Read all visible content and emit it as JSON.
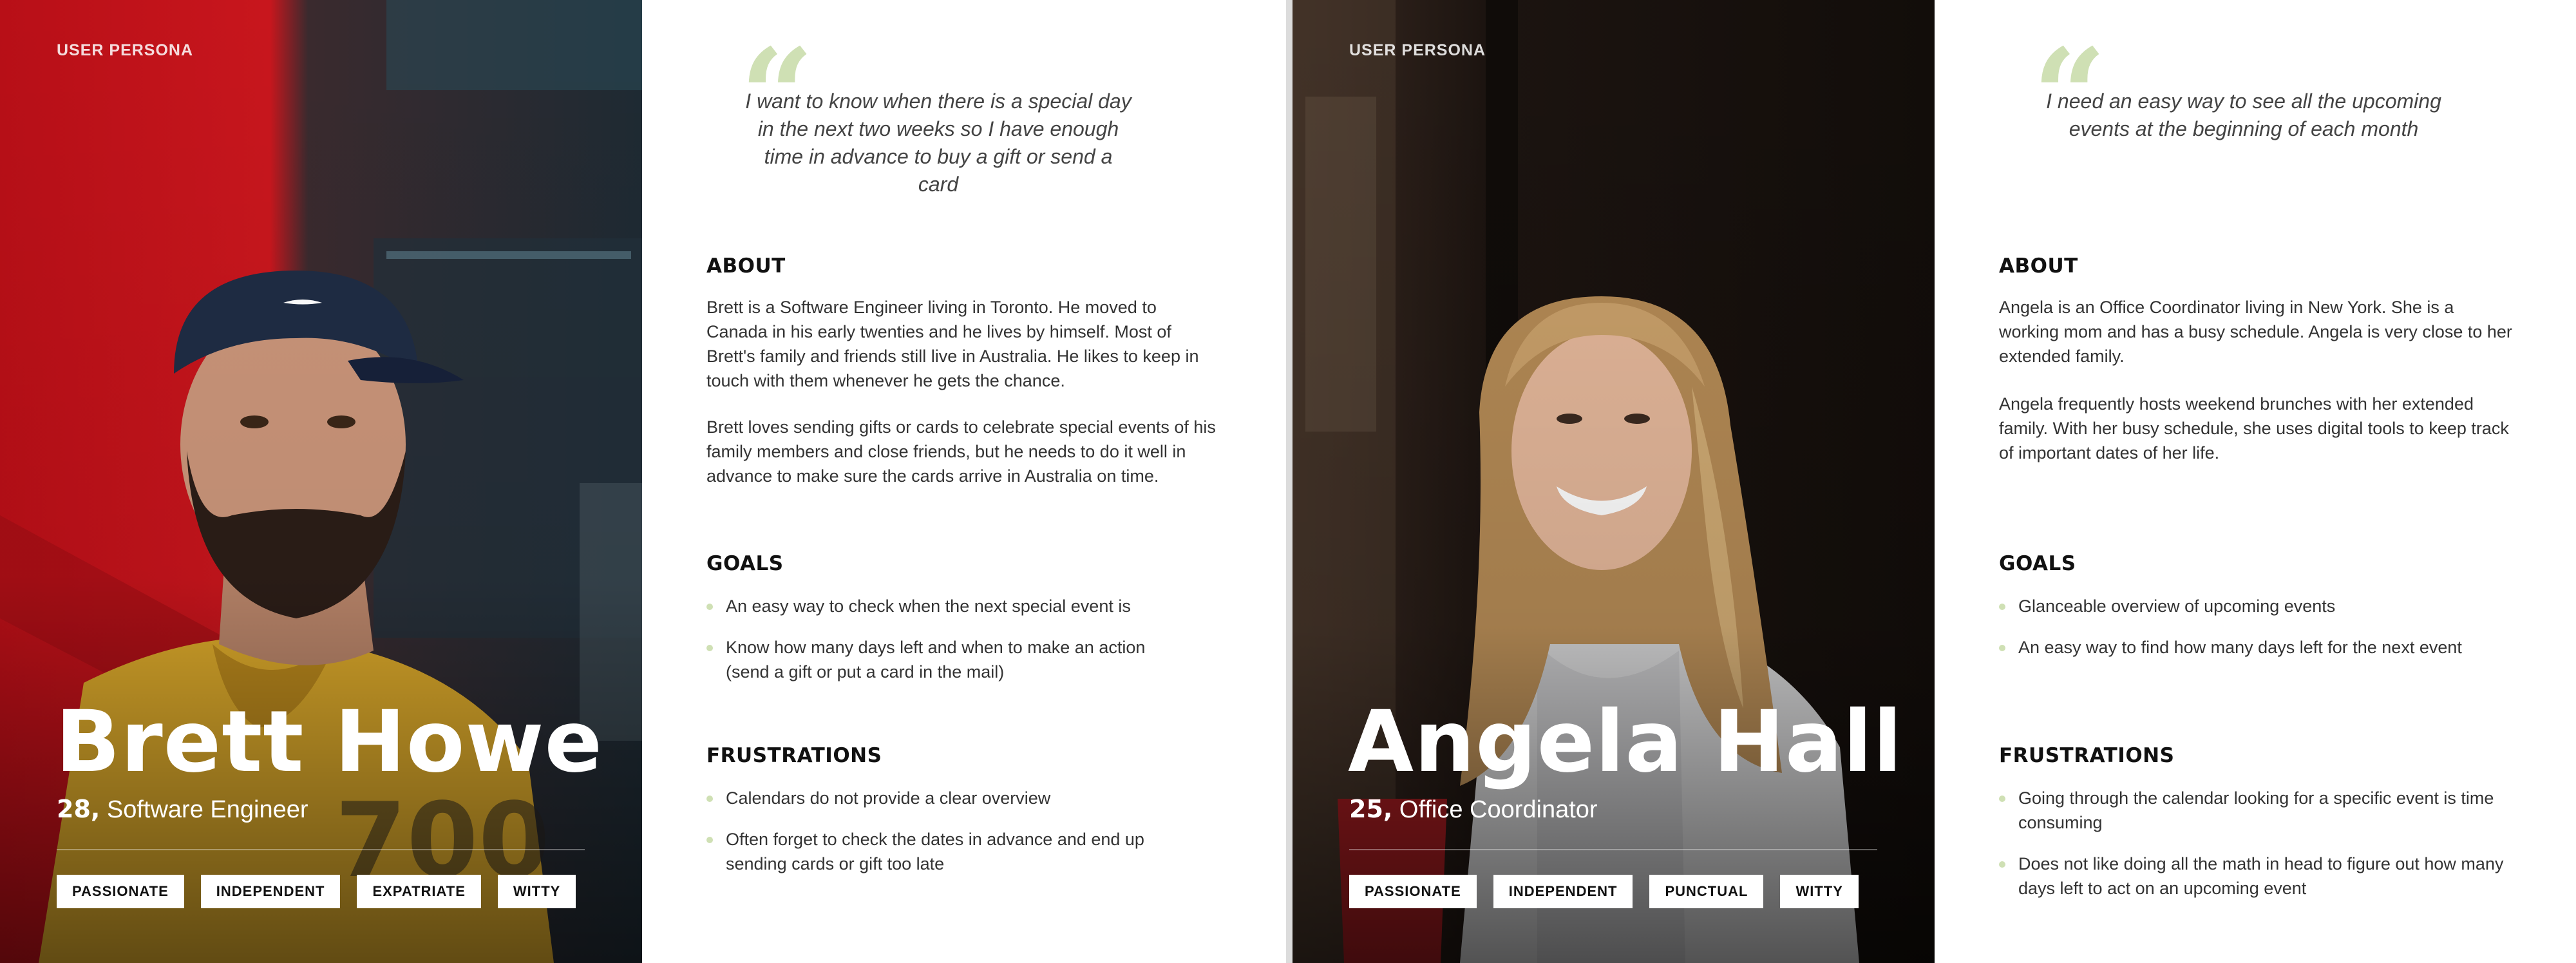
{
  "personas": [
    {
      "label": "USER PERSONA",
      "name": "Brett Howe",
      "age": "28,",
      "role": "Software Engineer",
      "tags": [
        "PASSIONATE",
        "INDEPENDENT",
        "EXPATRIATE",
        "WITTY"
      ],
      "quote": "I want to know when there is a special day in the next two weeks so I have enough time in advance to buy a gift or send a card",
      "about_title": "ABOUT",
      "about": [
        "Brett is a Software Engineer living in Toronto. He moved to Canada in his early twenties and he lives by himself. Most of Brett's family and friends still live in Australia. He likes to keep in touch with them whenever he gets the chance.",
        "Brett loves sending gifts or cards to celebrate special events of his family members and close friends, but he needs to do it well in advance to make sure the cards arrive in Australia on time."
      ],
      "goals_title": "GOALS",
      "goals": [
        "An easy way to check when the next special event is",
        "Know how many days left and when to make an action (send a gift or put a card in the mail)"
      ],
      "frustrations_title": "FRUSTRATIONS",
      "frustrations": [
        "Calendars do not provide a clear overview",
        "Often forget to check the dates in advance and end up sending cards or gift too late"
      ]
    },
    {
      "label": "USER PERSONA",
      "name": "Angela Hall",
      "age": "25,",
      "role": "Office Coordinator",
      "tags": [
        "PASSIONATE",
        "INDEPENDENT",
        "PUNCTUAL",
        "WITTY"
      ],
      "quote": "I need an easy way to see all the upcoming events at the beginning of each month",
      "about_title": "ABOUT",
      "about": [
        "Angela is an Office Coordinator living in New York. She is a working mom and has a busy schedule. Angela is very close to her extended family.",
        "Angela frequently hosts weekend brunches with her extended family. With her busy schedule, she uses digital tools to keep track of important dates of her life."
      ],
      "goals_title": "GOALS",
      "goals": [
        "Glanceable overview of upcoming events",
        "An easy way to find how many days left for the next event"
      ],
      "frustrations_title": "FRUSTRATIONS",
      "frustrations": [
        "Going through the calendar looking for a specific event is time consuming",
        "Does not like doing all the math in head to figure out how many days left to act on an upcoming event"
      ]
    }
  ],
  "colors": {
    "accent": "#cfe0b4",
    "photo1_red": "#c8161d",
    "photo1_shirt": "#d9a72a",
    "photo2_dark": "#1c1410"
  }
}
